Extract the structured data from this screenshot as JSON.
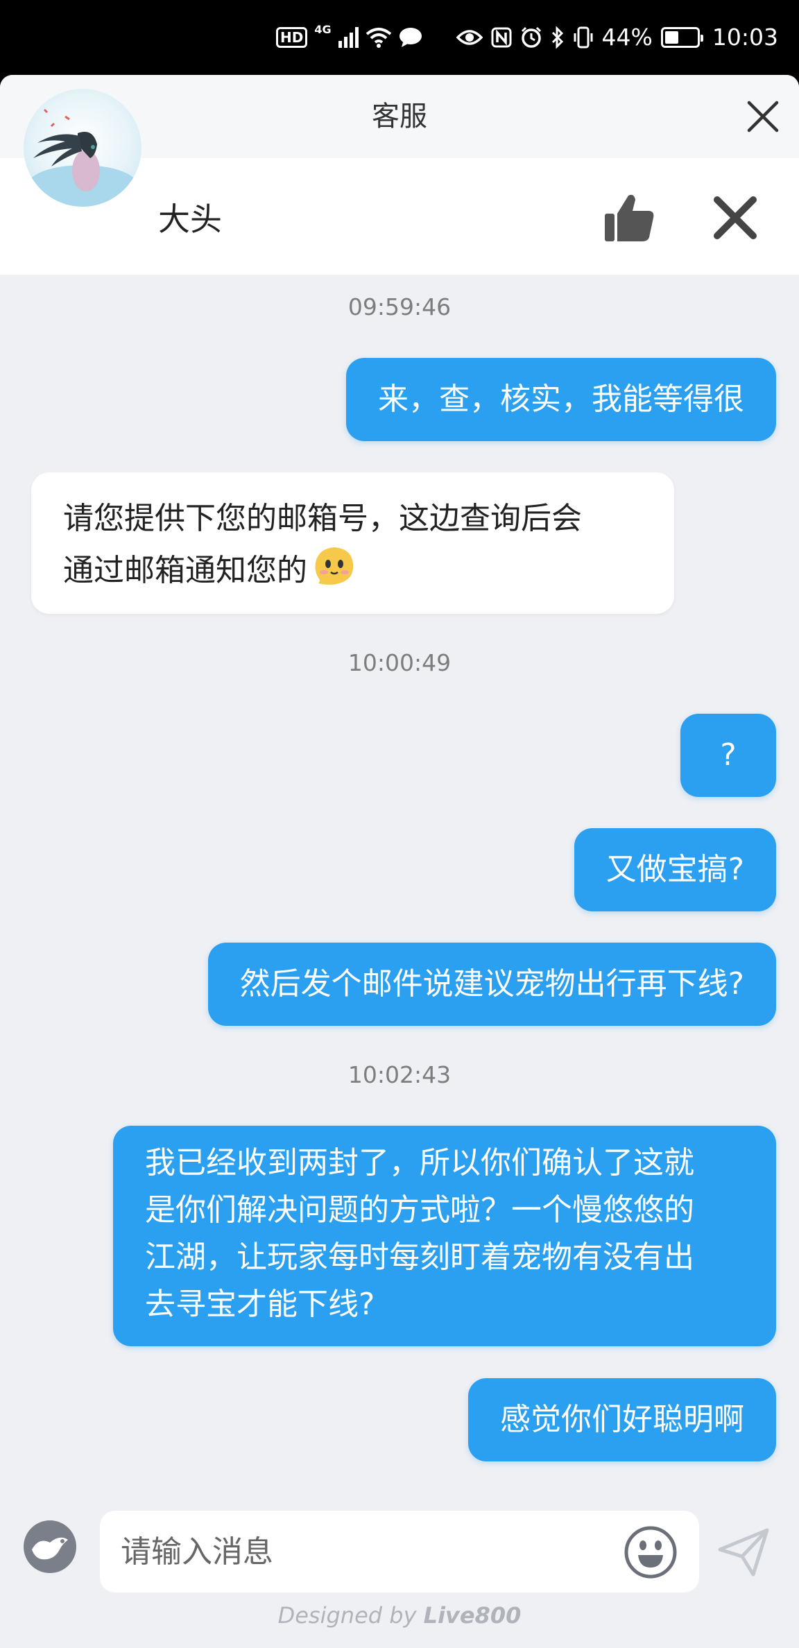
{
  "status_bar": {
    "hd_badge": "HD",
    "network": "4G",
    "battery_percent": "44%",
    "battery_level": 0.44,
    "time": "10:03",
    "icons": [
      "hd-icon",
      "signal-icon",
      "wifi-icon",
      "message-icon",
      "eye-icon",
      "nfc-icon",
      "alarm-icon",
      "bluetooth-icon",
      "vibrate-icon",
      "battery-icon"
    ]
  },
  "sheet": {
    "title": "客服"
  },
  "agent": {
    "name": "大头"
  },
  "messages": [
    {
      "type": "timestamp",
      "text": "09:59:46"
    },
    {
      "type": "sent",
      "text": "来，查，核实，我能等得很"
    },
    {
      "type": "received",
      "lines": [
        "请您提供下您的邮箱号，这边查询后会",
        "通过邮箱通知您的"
      ],
      "emoji": "smile-emoji"
    },
    {
      "type": "timestamp",
      "text": "10:00:49"
    },
    {
      "type": "sent",
      "text": "?"
    },
    {
      "type": "sent",
      "text": "又做宝搞?"
    },
    {
      "type": "sent",
      "text": "然后发个邮件说建议宠物出行再下线?"
    },
    {
      "type": "timestamp",
      "text": "10:02:43"
    },
    {
      "type": "sent",
      "lines": [
        "我已经收到两封了，所以你们确认了这就",
        "是你们解决问题的方式啦？一个慢悠悠的",
        "江湖，让玩家每时每刻盯着宠物有没有出",
        "去寻宝才能下线?"
      ]
    },
    {
      "type": "sent",
      "text": "感觉你们好聪明啊"
    }
  ],
  "input": {
    "placeholder": "请输入消息"
  },
  "footer": {
    "prefix": "Designed by",
    "brand": "Live800"
  },
  "colors": {
    "sent_bubble": "#2b9ff0",
    "received_bubble": "#ffffff",
    "background": "#eef0f4"
  }
}
